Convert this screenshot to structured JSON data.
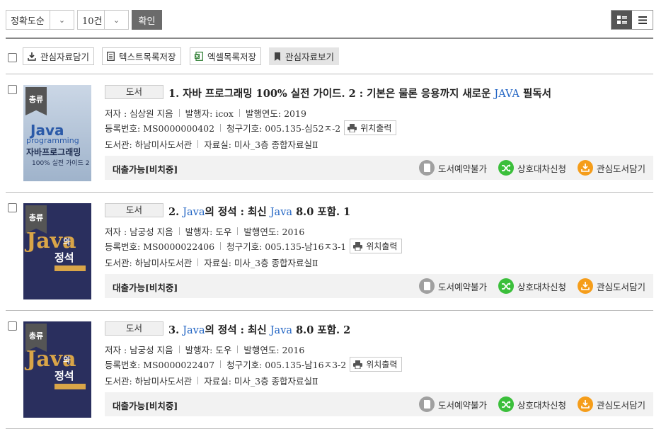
{
  "toolbar": {
    "sort_value": "정확도순",
    "count_value": "10건",
    "confirm_label": "확인"
  },
  "actions": {
    "save_interest": "관심자료담기",
    "save_text": "텍스트목록저장",
    "save_excel": "엑셀목록저장",
    "view_interest": "관심자료보기"
  },
  "labels": {
    "location_print": "위치출력",
    "reserve": "도서예약불가",
    "interlibrary": "상호대차신청",
    "fav_library": "관심도서담기"
  },
  "colors": {
    "link_blue": "#2466c4",
    "reserve_gray": "#a0a0a0",
    "interlibrary_green": "#3bbf3b",
    "fav_orange": "#f59d1a"
  },
  "results": [
    {
      "ribbon": "총류",
      "type": "도서",
      "title_prefix": "1. 자바 프로그래밍 100% 실전 가이드. 2 : 기본은 물론 응용까지 새로운 ",
      "title_hl1": "JAVA",
      "title_mid": " 필독서",
      "title_hl2": "",
      "title_suffix": "",
      "author": "저자 : 심상원 지음",
      "publisher": "발행자: icox",
      "year": "발행연도: 2019",
      "reg_no": "등록번호: MS0000000402",
      "call_no": "청구기호: 005.135-심52ㅈ-2",
      "library": "도서관: 하남미사도서관",
      "room": "자료실: 미사_3층 종합자료실Ⅱ",
      "status": "대출가능[비치중]",
      "cover": {
        "line1": "Java",
        "line2": "programming",
        "line3": "자바프로그래밍",
        "line4": "100% 실전 가이드 2"
      }
    },
    {
      "ribbon": "총류",
      "type": "도서",
      "title_prefix": "2. ",
      "title_hl1": "Java",
      "title_mid": "의 정석 : 최신 ",
      "title_hl2": "Java",
      "title_suffix": " 8.0 포함. 1",
      "author": "저자 : 남궁성 지음",
      "publisher": "발행자: 도우",
      "year": "발행연도: 2016",
      "reg_no": "등록번호: MS0000022406",
      "call_no": "청구기호: 005.135-남16ㅈ3-1",
      "library": "도서관: 하남미사도서관",
      "room": "자료실: 미사_3층 종합자료실Ⅱ",
      "status": "대출가능[비치중]",
      "cover": {
        "line1": "Java",
        "line2": "의",
        "line3": "정석"
      }
    },
    {
      "ribbon": "총류",
      "type": "도서",
      "title_prefix": "3. ",
      "title_hl1": "Java",
      "title_mid": "의 정석 : 최신 ",
      "title_hl2": "Java",
      "title_suffix": " 8.0 포함. 2",
      "author": "저자 : 남궁성 지음",
      "publisher": "발행자: 도우",
      "year": "발행연도: 2016",
      "reg_no": "등록번호: MS0000022407",
      "call_no": "청구기호: 005.135-남16ㅈ3-2",
      "library": "도서관: 하남미사도서관",
      "room": "자료실: 미사_3층 종합자료실Ⅱ",
      "status": "대출가능[비치중]",
      "cover": {
        "line1": "Java",
        "line2": "의",
        "line3": "정석"
      }
    }
  ]
}
